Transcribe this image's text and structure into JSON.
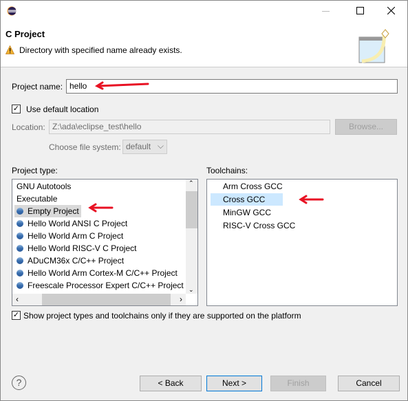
{
  "window": {
    "title": "C Project",
    "message": "Directory with specified name already exists.",
    "colors": {
      "selection": "#cce8ff",
      "arrow": "#e81123",
      "warning": "#f0b030"
    }
  },
  "form": {
    "project_name_label": "Project name:",
    "project_name_value": "hello",
    "use_default_label": "Use default location",
    "use_default_checked": true,
    "location_label": "Location:",
    "location_value": "Z:\\ada\\eclipse_test\\hello",
    "browse_label": "Browse...",
    "file_system_label": "Choose file system:",
    "file_system_value": "default"
  },
  "project_type": {
    "label": "Project type:",
    "items": [
      {
        "label": "GNU Autotools",
        "icon": false
      },
      {
        "label": "Executable",
        "icon": false
      },
      {
        "label": "Empty Project",
        "icon": true,
        "selected": true
      },
      {
        "label": "Hello World ANSI C Project",
        "icon": true
      },
      {
        "label": "Hello World Arm C Project",
        "icon": true
      },
      {
        "label": "Hello World RISC-V C Project",
        "icon": true
      },
      {
        "label": "ADuCM36x C/C++ Project",
        "icon": true
      },
      {
        "label": "Hello World Arm Cortex-M C/C++ Project",
        "icon": true
      },
      {
        "label": "Freescale Processor Expert C/C++ Project",
        "icon": true
      }
    ]
  },
  "toolchains": {
    "label": "Toolchains:",
    "items": [
      {
        "label": "Arm Cross GCC"
      },
      {
        "label": "Cross GCC",
        "selected": true
      },
      {
        "label": "MinGW GCC"
      },
      {
        "label": "RISC-V Cross GCC"
      }
    ]
  },
  "show_supported": {
    "label": "Show project types and toolchains only if they are supported on the platform",
    "checked": true
  },
  "buttons": {
    "help": "?",
    "back": "< Back",
    "next": "Next >",
    "finish": "Finish",
    "cancel": "Cancel"
  }
}
